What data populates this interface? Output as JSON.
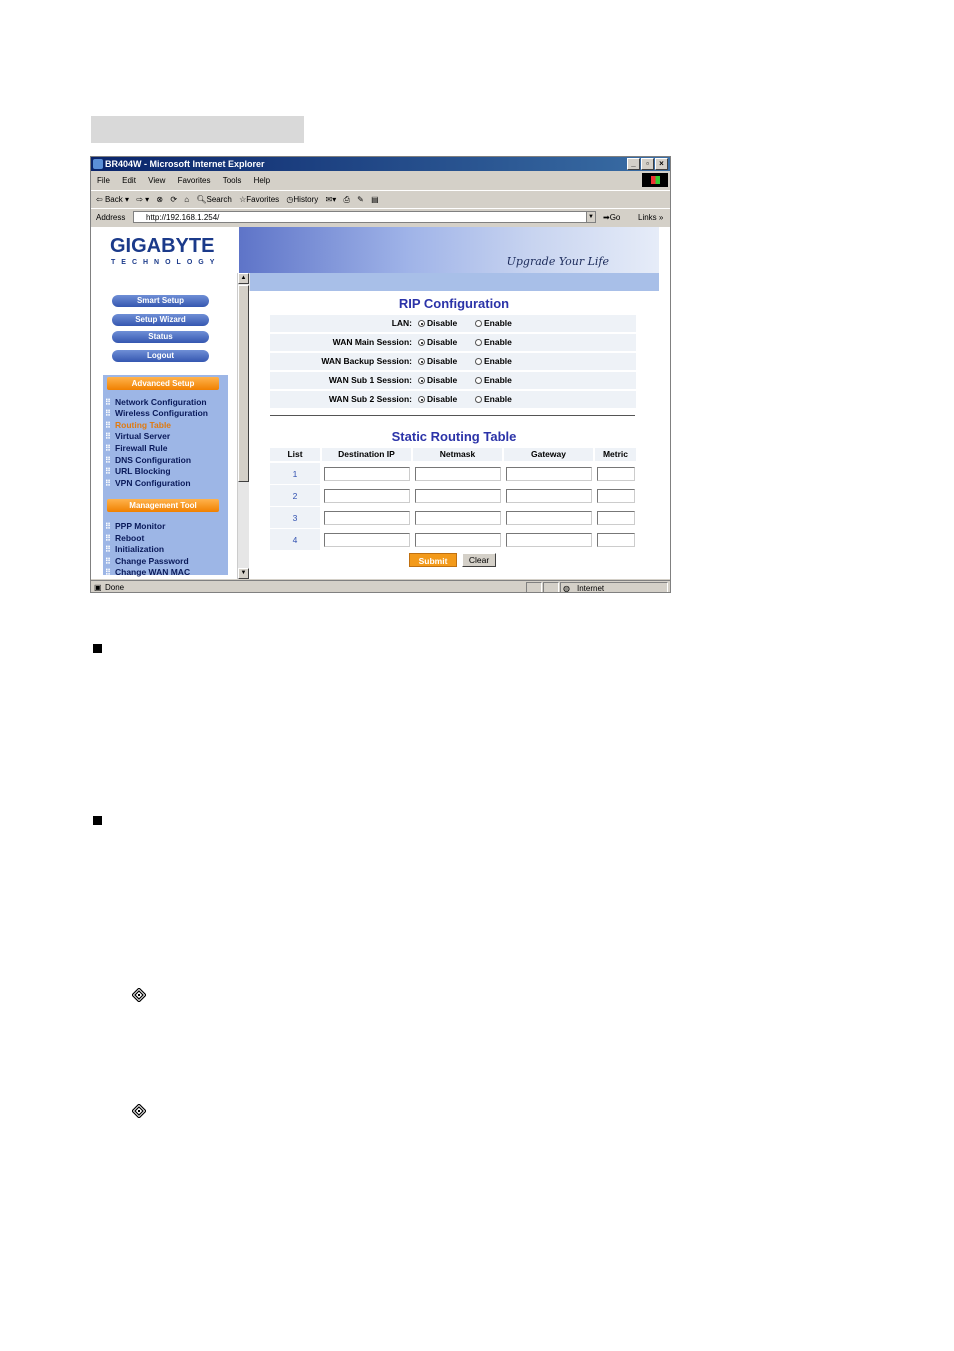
{
  "browser": {
    "title": "BR404W - Microsoft Internet Explorer",
    "menu": [
      "File",
      "Edit",
      "View",
      "Favorites",
      "Tools",
      "Help"
    ],
    "toolbar": {
      "back": "Back",
      "search": "Search",
      "favorites": "Favorites",
      "history": "History"
    },
    "address_label": "Address",
    "address_value": "http://192.168.1.254/",
    "go_label": "Go",
    "links_label": "Links",
    "status_text": "Done",
    "zone_text": "Internet"
  },
  "header": {
    "logo": "GIGABYTE",
    "logo_sub": "TECHNOLOGY",
    "slogan": "Upgrade Your Life"
  },
  "sidebar": {
    "buttons": [
      "Smart Setup",
      "Setup Wizard",
      "Status",
      "Logout"
    ],
    "advanced_heading": "Advanced Setup",
    "advanced_items": [
      "Network Configuration",
      "Wireless Configuration",
      "Routing Table",
      "Virtual Server",
      "Firewall Rule",
      "DNS Configuration",
      "URL Blocking",
      "VPN Configuration"
    ],
    "active_item": "Routing Table",
    "management_heading": "Management Tool",
    "management_items": [
      "PPP Monitor",
      "Reboot",
      "Initialization",
      "Change Password",
      "Change WAN MAC"
    ]
  },
  "rip": {
    "title": "RIP Configuration",
    "rows": [
      {
        "label": "LAN:",
        "selected": "Disable"
      },
      {
        "label": "WAN Main Session:",
        "selected": "Disable"
      },
      {
        "label": "WAN Backup Session:",
        "selected": "Disable"
      },
      {
        "label": "WAN Sub 1 Session:",
        "selected": "Disable"
      },
      {
        "label": "WAN Sub 2 Session:",
        "selected": "Disable"
      }
    ],
    "opt_disable": "Disable",
    "opt_enable": "Enable"
  },
  "static": {
    "title": "Static Routing Table",
    "columns": [
      "List",
      "Destination IP",
      "Netmask",
      "Gateway",
      "Metric"
    ],
    "rows": [
      "1",
      "2",
      "3",
      "4"
    ],
    "submit": "Submit",
    "clear": "Clear"
  }
}
